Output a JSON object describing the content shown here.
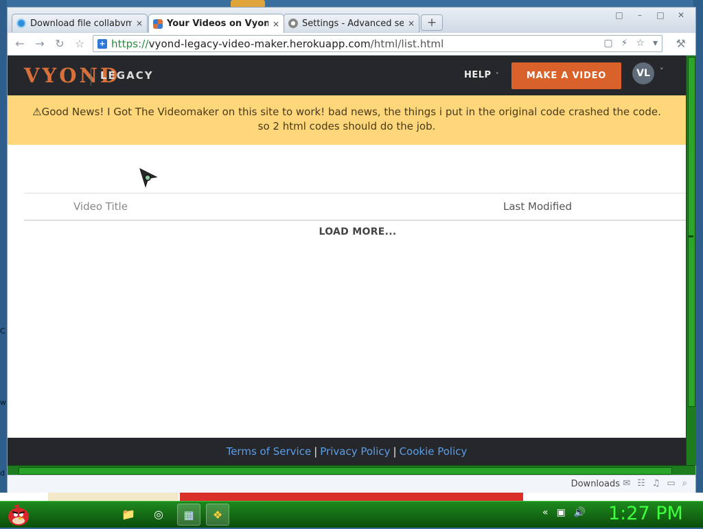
{
  "browser": {
    "tabs": [
      {
        "title": "Download file collabvm.e:",
        "favicon_color": "#2f8fd8"
      },
      {
        "title": "Your Videos on Vyond L",
        "favicon_color": "#d8703b"
      },
      {
        "title": "Settings - Advanced settir",
        "favicon_color": "#888888"
      }
    ],
    "new_tab_label": "+",
    "close_label": "×",
    "window_buttons": [
      "□",
      "–",
      "□",
      "✕"
    ],
    "url": {
      "scheme": "https://",
      "host": "vyond-legacy-video-maker.herokuapp.com",
      "path": "/html/list.html"
    },
    "nav": {
      "back": "←",
      "forward": "→",
      "reload": "↻",
      "bookmark": "☆"
    },
    "url_icons": [
      "▢",
      "⚡",
      "☆",
      "▾"
    ],
    "wrench": "⚒"
  },
  "site": {
    "logo": "VYOND",
    "logo_suffix": "LEGACY",
    "nav_help": "HELP",
    "nav_help_chevron": "˅",
    "cta": "MAKE A VIDEO",
    "avatar_initials": "VL",
    "avatar_chevron": "˅",
    "banner_icon": "⚠",
    "banner_text": "Good News! I Got The Videomaker on this site to work! bad news, the things i put in the original code crashed the code. so 2 html codes should do the job.",
    "table": {
      "col_title": "Video Title",
      "col_modified": "Last Modified"
    },
    "load_more": "LOAD MORE...",
    "footer": {
      "terms": "Terms of Service",
      "privacy": "Privacy Policy",
      "cookie": "Cookie Policy",
      "sep": "|"
    }
  },
  "downloads_bar": {
    "label": "Downloads",
    "icons": [
      "✉",
      "☷",
      "♫",
      "▭",
      "⌕"
    ]
  },
  "desktop": {
    "left_letters": [
      "C",
      "w",
      "d"
    ]
  },
  "taskbar": {
    "apps": [
      "📁",
      "◎",
      "▦",
      "❖"
    ],
    "tray": [
      "«",
      "▣",
      "🔊"
    ],
    "clock": "1:27 PM",
    "accent": "#3fff3f"
  }
}
